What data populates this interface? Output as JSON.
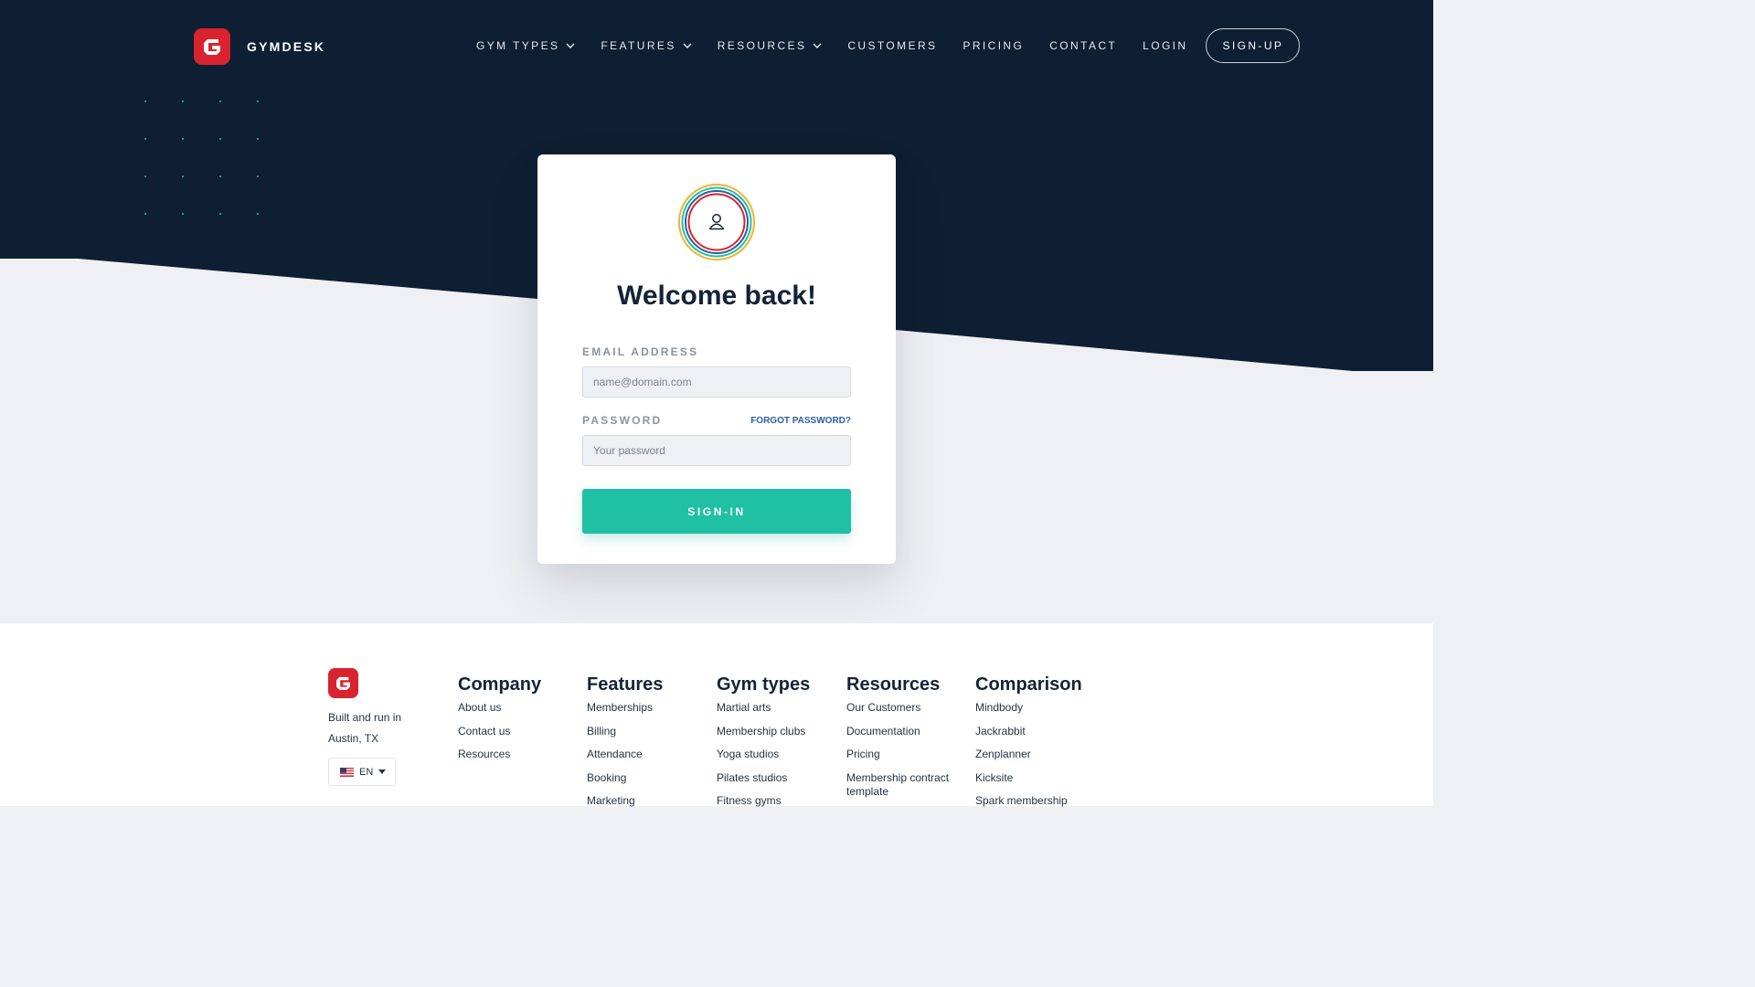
{
  "brand": {
    "name": "GYMDESK"
  },
  "nav": {
    "items": [
      {
        "label": "GYM TYPES",
        "dropdown": true
      },
      {
        "label": "FEATURES",
        "dropdown": true
      },
      {
        "label": "RESOURCES",
        "dropdown": true
      },
      {
        "label": "CUSTOMERS",
        "dropdown": false
      },
      {
        "label": "PRICING",
        "dropdown": false
      },
      {
        "label": "CONTACT",
        "dropdown": false
      },
      {
        "label": "LOGIN",
        "dropdown": false
      }
    ],
    "signup_label": "SIGN-UP"
  },
  "login": {
    "title": "Welcome back!",
    "email_label": "EMAIL ADDRESS",
    "email_placeholder": "name@domain.com",
    "email_value": "",
    "password_label": "PASSWORD",
    "password_placeholder": "Your password",
    "password_value": "",
    "forgot_label": "FORGOT PASSWORD?",
    "submit_label": "SIGN-IN"
  },
  "footer": {
    "built_line1": "Built and run in",
    "built_line2": "Austin, TX",
    "language": "EN",
    "columns": [
      {
        "title": "Company",
        "links": [
          "About us",
          "Contact us",
          "Resources"
        ]
      },
      {
        "title": "Features",
        "links": [
          "Memberships",
          "Billing",
          "Attendance",
          "Booking",
          "Marketing"
        ]
      },
      {
        "title": "Gym types",
        "links": [
          "Martial arts",
          "Membership clubs",
          "Yoga studios",
          "Pilates studios",
          "Fitness gyms"
        ]
      },
      {
        "title": "Resources",
        "links": [
          "Our Customers",
          "Documentation",
          "Pricing",
          "Membership contract template"
        ]
      },
      {
        "title": "Comparison",
        "links": [
          "Mindbody",
          "Jackrabbit",
          "Zenplanner",
          "Kicksite",
          "Spark membership"
        ]
      }
    ]
  },
  "colors": {
    "navy": "#0e1f33",
    "accent": "#20c0a5",
    "brand_red": "#d9232f",
    "page_bg": "#eff0f4"
  },
  "icons": {
    "logo": "gymdesk-logo-icon",
    "avatar": "user-icon",
    "dropdown": "chevron-down-icon",
    "flag": "us-flag-icon"
  }
}
